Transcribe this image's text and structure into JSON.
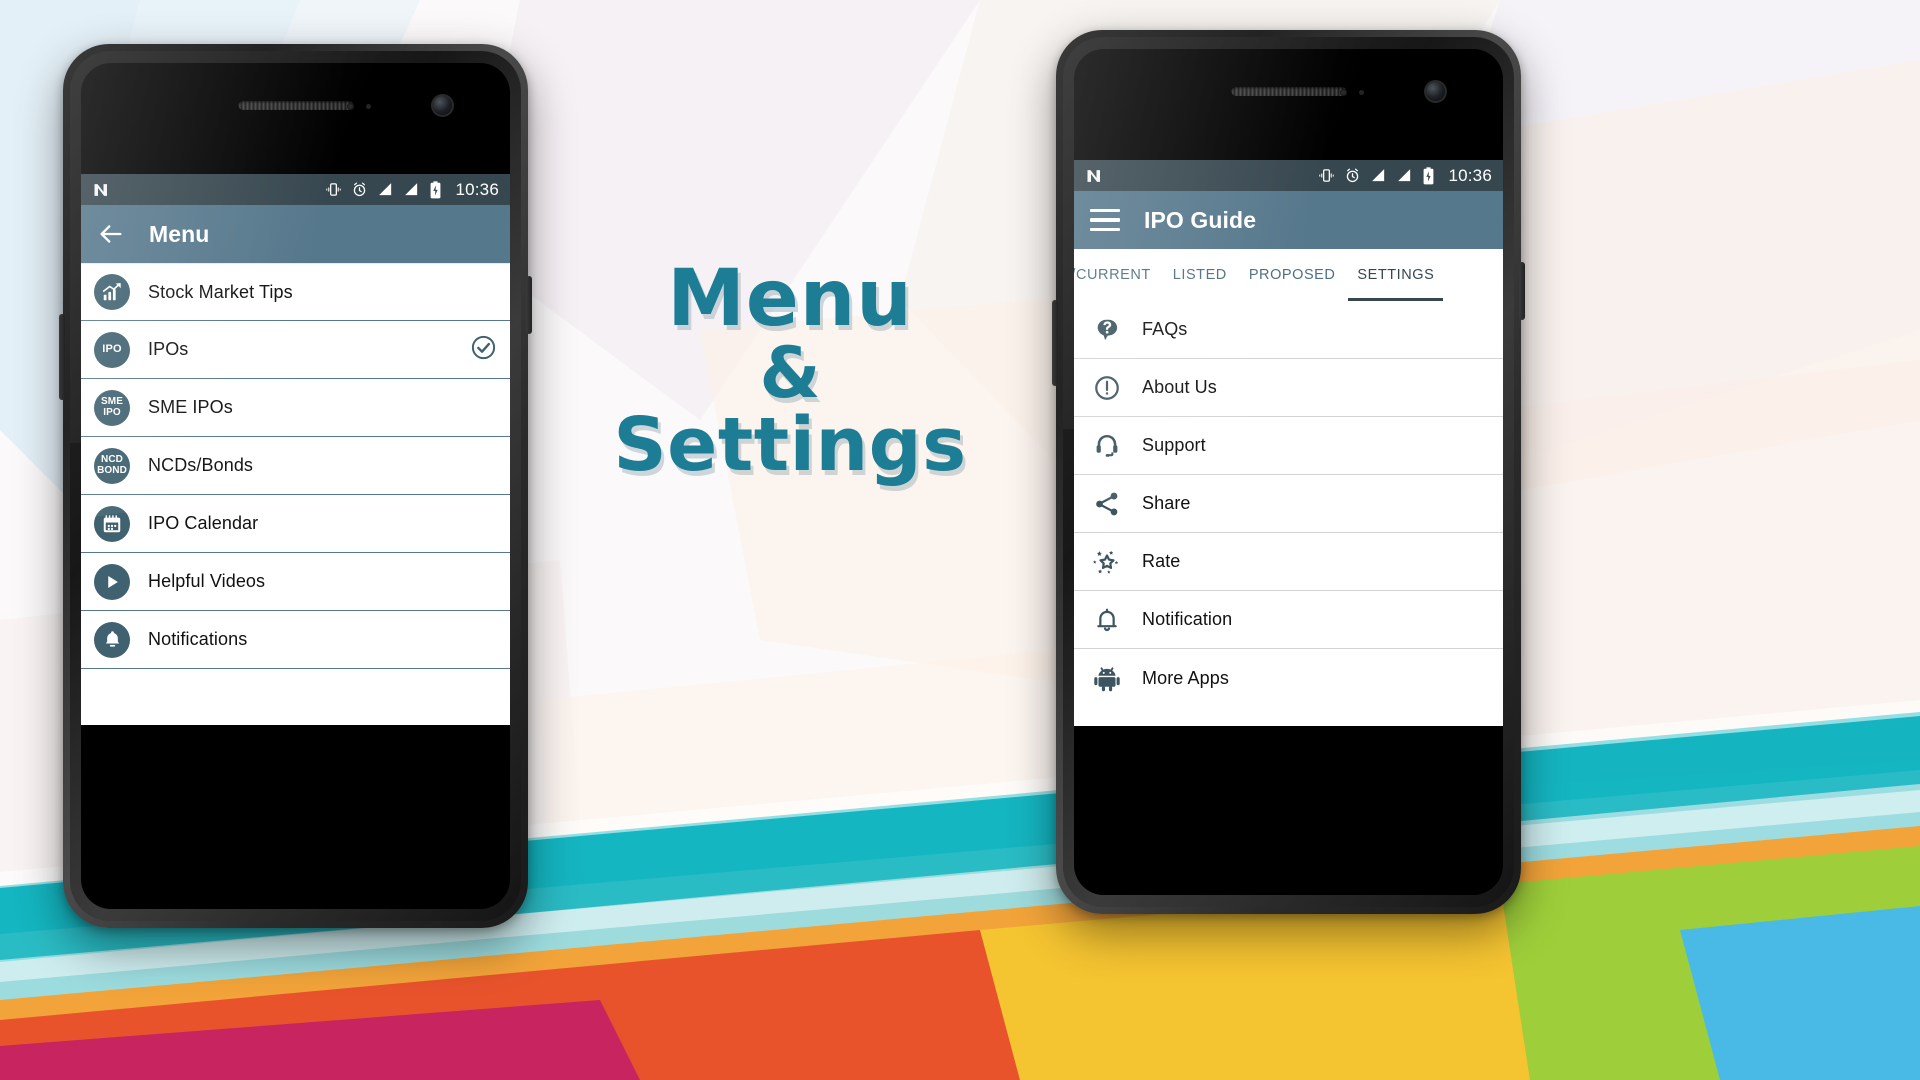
{
  "headline": {
    "line1": "Menu",
    "line2": "&",
    "line3": "Settings"
  },
  "colors": {
    "status_bar": "#37474f",
    "app_bar": "#56788c",
    "accent": "#1d7d94",
    "icon_circle": "#3f6170",
    "divider_left": "#56788c",
    "divider_right": "#d4d4d4"
  },
  "left_phone": {
    "status": {
      "logo": "android-n-logo",
      "time": "10:36",
      "icons": [
        "vibrate-icon",
        "alarm-icon",
        "signal-bars-icon",
        "signal-bars-icon",
        "battery-charging-icon"
      ]
    },
    "appbar": {
      "back_icon": "back-arrow-icon",
      "title": "Menu"
    },
    "items": [
      {
        "icon": "chart-growth-icon",
        "icon_text": "",
        "label": "Stock Market Tips",
        "checked": false
      },
      {
        "icon": "ipo-badge-icon",
        "icon_text": "IPO",
        "label": "IPOs",
        "checked": true
      },
      {
        "icon": "sme-ipo-badge-icon",
        "icon_text": "SME\nIPO",
        "label": "SME IPOs",
        "checked": false
      },
      {
        "icon": "ncd-bond-badge-icon",
        "icon_text": "NCD\nBOND",
        "label": "NCDs/Bonds",
        "checked": false
      },
      {
        "icon": "calendar-icon",
        "icon_text": "",
        "label": "IPO Calendar",
        "checked": false
      },
      {
        "icon": "play-video-icon",
        "icon_text": "",
        "label": "Helpful Videos",
        "checked": false
      },
      {
        "icon": "bell-icon",
        "icon_text": "",
        "label": "Notifications",
        "checked": false
      }
    ]
  },
  "right_phone": {
    "status": {
      "logo": "android-n-logo",
      "time": "10:36",
      "icons": [
        "vibrate-icon",
        "alarm-icon",
        "signal-bars-icon",
        "signal-bars-icon",
        "battery-charging-icon"
      ]
    },
    "appbar": {
      "menu_icon": "hamburger-icon",
      "title": "IPO Guide"
    },
    "tabs": [
      {
        "label": "ING/CURRENT",
        "active": false
      },
      {
        "label": "LISTED",
        "active": false
      },
      {
        "label": "PROPOSED",
        "active": false
      },
      {
        "label": "SETTINGS",
        "active": true
      }
    ],
    "items": [
      {
        "icon": "faq-head-question-icon",
        "label": "FAQs"
      },
      {
        "icon": "exclamation-circle-icon",
        "label": "About Us"
      },
      {
        "icon": "headset-icon",
        "label": "Support"
      },
      {
        "icon": "share-nodes-icon",
        "label": "Share"
      },
      {
        "icon": "stars-rate-icon",
        "label": "Rate"
      },
      {
        "icon": "bell-outline-icon",
        "label": "Notification"
      },
      {
        "icon": "android-robot-icon",
        "label": "More Apps"
      }
    ]
  }
}
